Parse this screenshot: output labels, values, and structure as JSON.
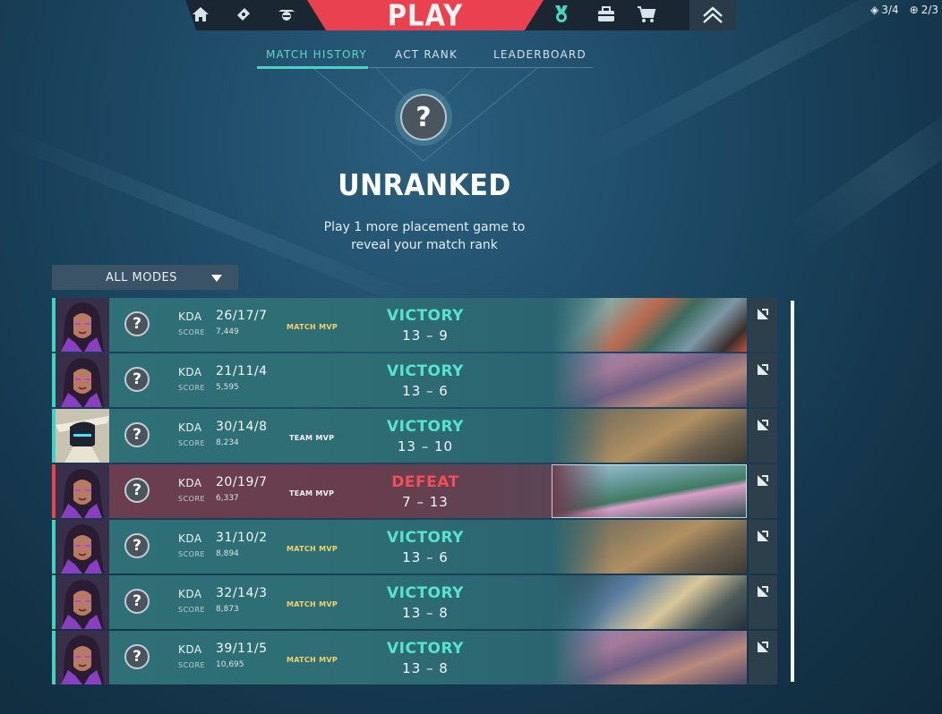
{
  "nav": {
    "play_label": "PLAY",
    "left_icons": [
      "home-icon",
      "collection-icon",
      "agents-icon"
    ],
    "right_icons": [
      "career-icon",
      "battlepass-icon",
      "store-icon"
    ],
    "rank_icon": "rank-chevron-icon",
    "counters": [
      {
        "icon": "diamond-icon",
        "value": "3/4"
      },
      {
        "icon": "radiant-point-icon",
        "value": "2/3"
      }
    ]
  },
  "subtabs": [
    {
      "label": "MATCH HISTORY",
      "active": true
    },
    {
      "label": "ACT RANK",
      "active": false
    },
    {
      "label": "LEADERBOARD",
      "active": false
    }
  ],
  "rank": {
    "badge_glyph": "?",
    "title": "UNRANKED",
    "subtitle_line1": "Play 1 more placement game to",
    "subtitle_line2": "reveal your match rank"
  },
  "filter": {
    "selected": "ALL MODES"
  },
  "labels": {
    "kda": "KDA",
    "score": "SCORE"
  },
  "matches": [
    {
      "agent": "reyna",
      "kda": "26/17/7",
      "score": "7,449",
      "mvp": "MATCH MVP",
      "mvp_type": "match",
      "result": "VICTORY",
      "team_score": "13 – 9",
      "map_style": "a"
    },
    {
      "agent": "reyna",
      "kda": "21/11/4",
      "score": "5,595",
      "mvp": "",
      "mvp_type": "",
      "result": "VICTORY",
      "team_score": "13 – 6",
      "map_style": "b"
    },
    {
      "agent": "cypher",
      "kda": "30/14/8",
      "score": "8,234",
      "mvp": "TEAM MVP",
      "mvp_type": "team",
      "result": "VICTORY",
      "team_score": "13 – 10",
      "map_style": "c"
    },
    {
      "agent": "reyna",
      "kda": "20/19/7",
      "score": "6,337",
      "mvp": "TEAM MVP",
      "mvp_type": "team",
      "result": "DEFEAT",
      "team_score": "7 – 13",
      "map_style": "d"
    },
    {
      "agent": "reyna",
      "kda": "31/10/2",
      "score": "8,894",
      "mvp": "MATCH MVP",
      "mvp_type": "match",
      "result": "VICTORY",
      "team_score": "13 – 6",
      "map_style": "c"
    },
    {
      "agent": "reyna",
      "kda": "32/14/3",
      "score": "8,873",
      "mvp": "MATCH MVP",
      "mvp_type": "match",
      "result": "VICTORY",
      "team_score": "13 – 8",
      "map_style": "e"
    },
    {
      "agent": "reyna",
      "kda": "39/11/5",
      "score": "10,695",
      "mvp": "MATCH MVP",
      "mvp_type": "match",
      "result": "VICTORY",
      "team_score": "13 – 8",
      "map_style": "b"
    }
  ],
  "colors": {
    "victory": "#58e3cf",
    "defeat": "#f14e5a",
    "play_red": "#e9414f",
    "accent_teal": "#49d3c0",
    "match_mvp": "#f1d56a"
  }
}
